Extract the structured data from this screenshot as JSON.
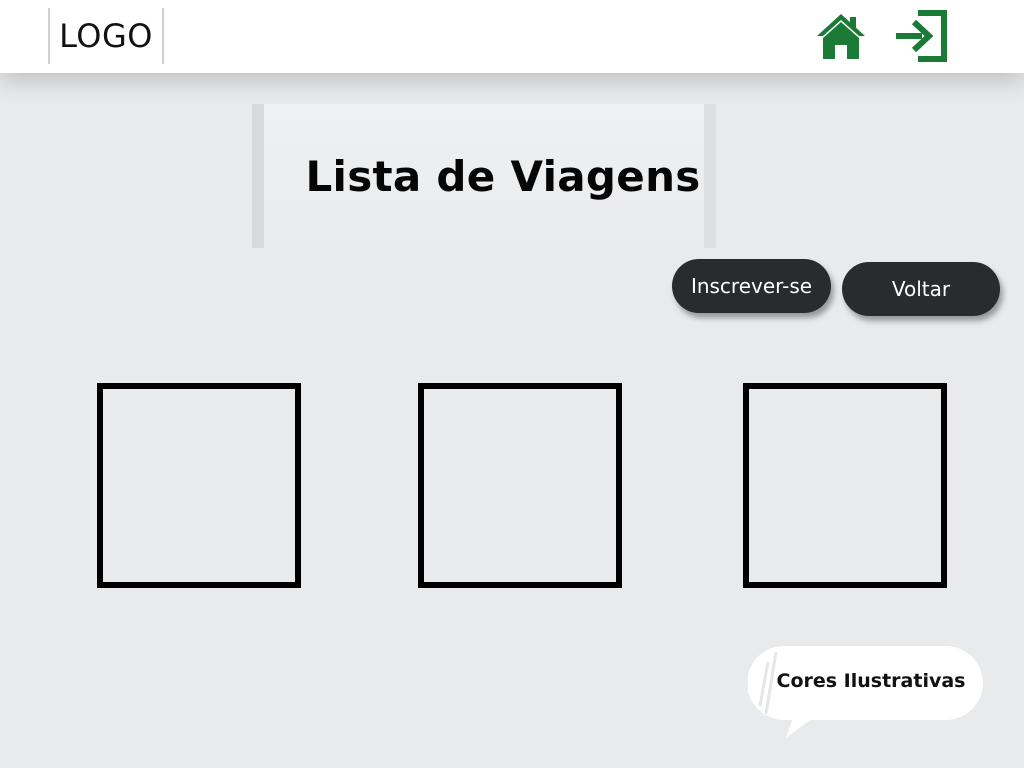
{
  "header": {
    "logo_text": "LOGO",
    "home_icon": "home-icon",
    "logout_icon": "sign-in-arrow-icon",
    "icon_color": "#1b7a36"
  },
  "main": {
    "title": "Lista de Viagens",
    "buttons": {
      "enroll_label": "Inscrever-se",
      "back_label": "Voltar"
    },
    "cards_count_visible": 3
  },
  "note": {
    "text": "Cores Ilustrativas"
  },
  "colors": {
    "background": "#e9eaec",
    "header": "#ffffff",
    "button": "#2a2b2e",
    "card_border": "#000000"
  }
}
